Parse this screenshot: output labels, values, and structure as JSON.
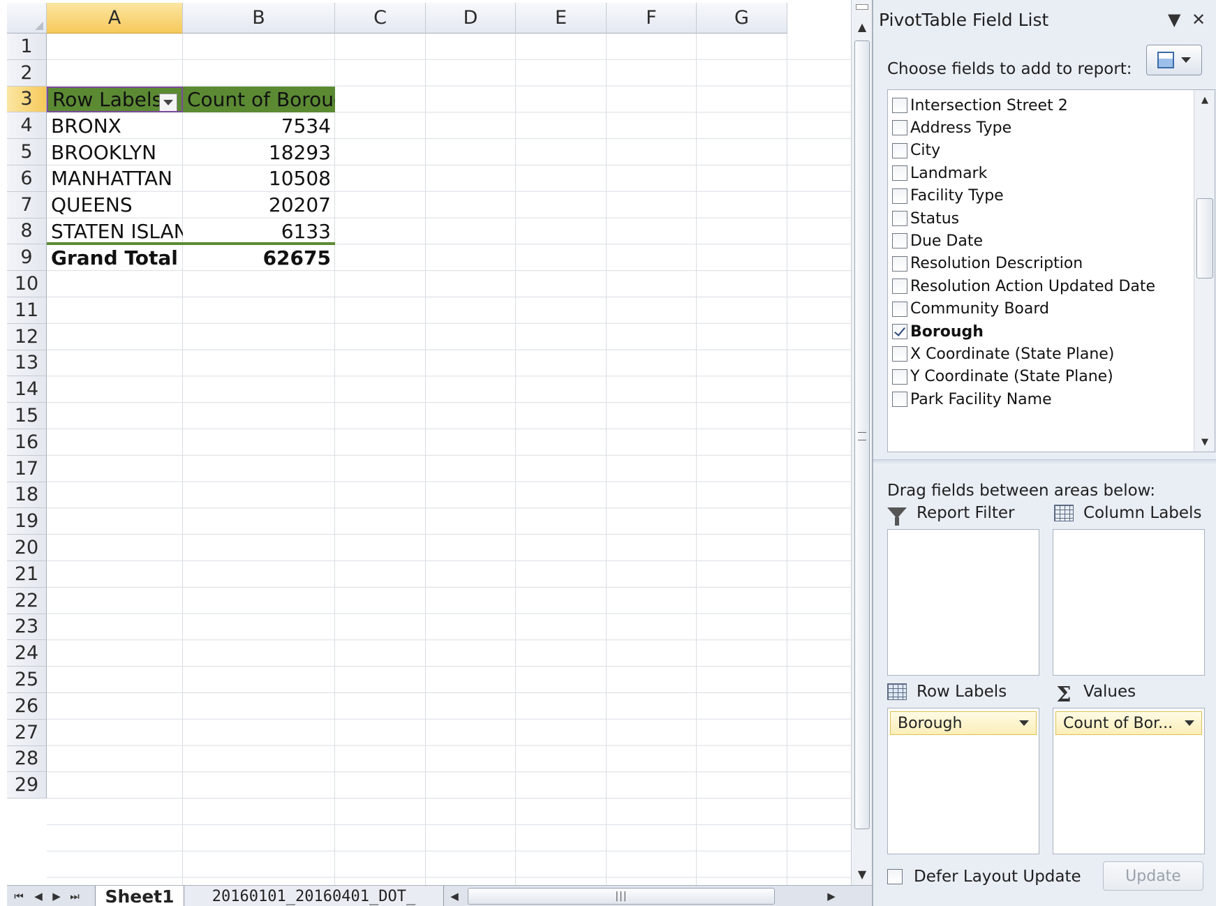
{
  "sheet": {
    "columns": [
      "A",
      "B",
      "C",
      "D",
      "E",
      "F",
      "G"
    ],
    "active_column": "A",
    "rows": [
      "1",
      "2",
      "3",
      "4",
      "5",
      "6",
      "7",
      "8",
      "9",
      "10",
      "11",
      "12",
      "13",
      "14",
      "15",
      "16",
      "17",
      "18",
      "19",
      "20",
      "21",
      "22",
      "23",
      "24",
      "25",
      "26",
      "27",
      "28",
      "29"
    ],
    "active_row": "3",
    "pivot": {
      "header_row_labels": "Row Labels",
      "header_values": "Count of Borough",
      "rows": [
        {
          "label": "BRONX",
          "value": "7534"
        },
        {
          "label": "BROOKLYN",
          "value": "18293"
        },
        {
          "label": "MANHATTAN",
          "value": "10508"
        },
        {
          "label": "QUEENS",
          "value": "20207"
        },
        {
          "label": "STATEN ISLAND",
          "value": "6133"
        }
      ],
      "grand_total_label": "Grand Total",
      "grand_total_value": "62675"
    },
    "colors": {
      "pivot_header": "#5b8a33",
      "active_header": "#f6c95b"
    }
  },
  "tabs": {
    "items": [
      {
        "label": "Sheet1",
        "active": true
      },
      {
        "label": "20160101_20160401_DOT_",
        "active": false
      }
    ],
    "hscroll_grip": "|||"
  },
  "pane": {
    "title": "PivotTable Field List",
    "choose_label": "Choose fields to add to report:",
    "fields": [
      {
        "label": "Intersection Street 2",
        "checked": false
      },
      {
        "label": "Address Type",
        "checked": false
      },
      {
        "label": "City",
        "checked": false
      },
      {
        "label": "Landmark",
        "checked": false
      },
      {
        "label": "Facility Type",
        "checked": false
      },
      {
        "label": "Status",
        "checked": false
      },
      {
        "label": "Due Date",
        "checked": false
      },
      {
        "label": "Resolution Description",
        "checked": false
      },
      {
        "label": "Resolution Action Updated Date",
        "checked": false
      },
      {
        "label": "Community Board",
        "checked": false
      },
      {
        "label": "Borough",
        "checked": true
      },
      {
        "label": "X Coordinate (State Plane)",
        "checked": false
      },
      {
        "label": "Y Coordinate (State Plane)",
        "checked": false
      },
      {
        "label": "Park Facility Name",
        "checked": false
      }
    ],
    "drag_label": "Drag fields between areas below:",
    "areas": {
      "report_filter": "Report Filter",
      "column_labels": "Column Labels",
      "row_labels": "Row Labels",
      "values": "Values"
    },
    "row_labels_chip": "Borough",
    "values_chip": "Count of Bor...",
    "defer_label": "Defer Layout Update",
    "update_label": "Update"
  }
}
